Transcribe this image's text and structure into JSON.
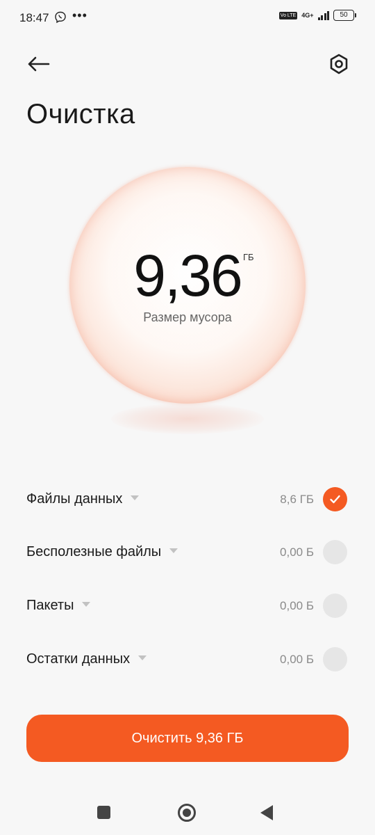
{
  "status_bar": {
    "time": "18:47",
    "dots": "•••",
    "volte": "Vo LTE",
    "network": "4G+",
    "battery": "50"
  },
  "header": {
    "title": "Очистка",
    "back_icon": "arrow-left-icon",
    "settings_icon": "hexagon-settings-icon"
  },
  "summary": {
    "value": "9,36",
    "unit": "ГБ",
    "label": "Размер мусора"
  },
  "categories": [
    {
      "label": "Файлы данных",
      "size": "8,6 ГБ",
      "checked": true
    },
    {
      "label": "Бесполезные файлы",
      "size": "0,00 Б",
      "checked": false
    },
    {
      "label": "Пакеты",
      "size": "0,00 Б",
      "checked": false
    },
    {
      "label": "Остатки данных",
      "size": "0,00 Б",
      "checked": false
    }
  ],
  "action": {
    "label": "Очистить 9,36 ГБ"
  },
  "colors": {
    "accent": "#f45a22",
    "background": "#f7f7f7"
  }
}
